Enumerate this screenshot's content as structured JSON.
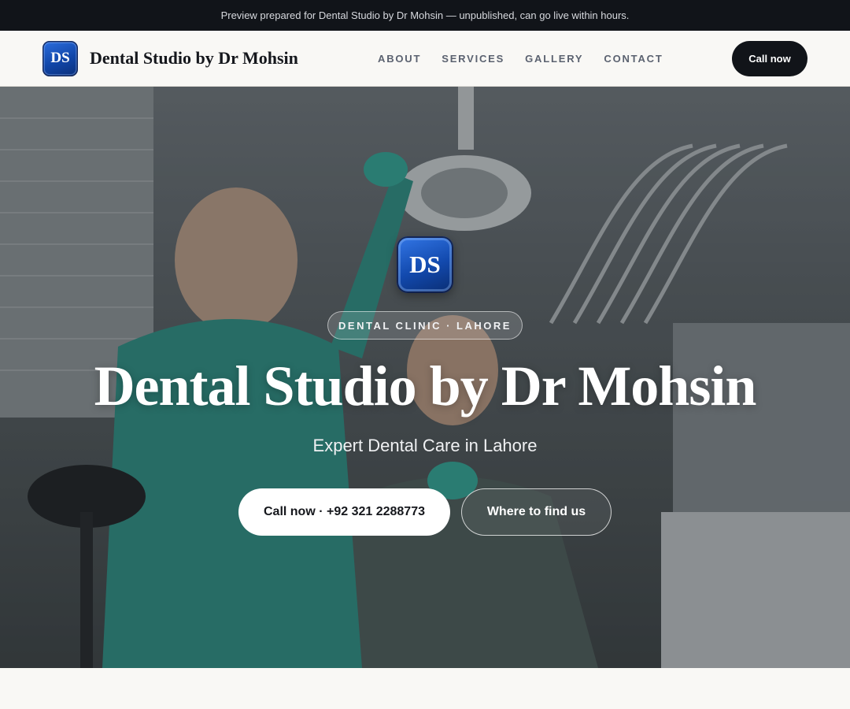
{
  "preview_bar": {
    "text": "Preview prepared for Dental Studio by Dr Mohsin — unpublished, can go live within hours."
  },
  "header": {
    "logo_initials": "DS",
    "brand_name": "Dental Studio by Dr Mohsin",
    "nav": [
      "ABOUT",
      "SERVICES",
      "GALLERY",
      "CONTACT"
    ],
    "cta_label": "Call now"
  },
  "hero": {
    "background_image": "dentist-treating-patient-photo",
    "logo_initials": "DS",
    "badge": "DENTAL CLINIC · LAHORE",
    "title": "Dental Studio by Dr Mohsin",
    "subtitle": "Expert Dental Care in Lahore",
    "primary_button": "Call now · +92 321 2288773",
    "secondary_button": "Where to find us"
  },
  "colors": {
    "dark": "#111419",
    "page_bg": "#f9f8f5",
    "brand_blue": "#1249ad",
    "nav_text": "#5b6270"
  }
}
